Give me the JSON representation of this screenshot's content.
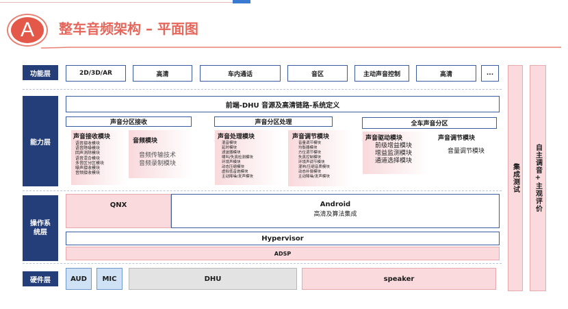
{
  "header": {
    "letter": "A",
    "title": "整车音频架构 – 平面图"
  },
  "layers": {
    "function": "功能层",
    "capability": "能力层",
    "os": "操作系统层",
    "hardware": "硬件层"
  },
  "function_items": [
    "2D/3D/AR",
    "高清",
    "车内通话",
    "音区",
    "主动声音控制",
    "高清",
    "..."
  ],
  "capability": {
    "top_bar": "前端-DHU 音源及高清链路-系统定义",
    "groups": [
      "声音分区接收",
      "声音分区处理",
      "全车声音分区"
    ],
    "modules": {
      "receive": {
        "title": "声音接收模块",
        "items": [
          "语音接收模块",
          "语音降噪模块",
          "回声消除模块",
          "语音混合模块",
          "多音区分区模块",
          "噪声接收模块",
          "音频接收模块"
        ]
      },
      "audio": {
        "title": "音频模块",
        "items": [
          "音频传输技术",
          "音频录制模块"
        ]
      },
      "process": {
        "title": "声音处理模块",
        "items": [
          "混音模块",
          "延时模块",
          "滤波器模块",
          "啸叫/失真检测模块",
          "环境声模块",
          "动态压缩模块",
          "虚拟低音炮模块",
          "主动降噪/发声模块"
        ]
      },
      "adjust": {
        "title": "声音调节模块",
        "items": [
          "音量调节模块",
          "均衡器模块",
          "方位调节模块",
          "失真控制模块",
          "环境声调节模块",
          "混响/压缩音质模块",
          "动态补偿模块",
          "主动降噪/发声模块"
        ]
      },
      "drive": {
        "title": "声音驱动模块",
        "items": [
          "前级增益模块",
          "增益监测模块",
          "通道选择模块"
        ]
      },
      "adjust2": {
        "title": "声音调节模块",
        "items": [
          "音量调节模块"
        ]
      }
    }
  },
  "os": {
    "qnx": "QNX",
    "android": "Android",
    "android_sub": "高清及算法集成",
    "hypervisor": "Hypervisor",
    "adsp": "ADSP"
  },
  "hardware": {
    "aud": "AUD",
    "mic": "MIC",
    "dhu": "DHU",
    "speaker": "speaker"
  },
  "side": {
    "integration": "集成测试",
    "evaluation": "自主调音+主观评价"
  }
}
